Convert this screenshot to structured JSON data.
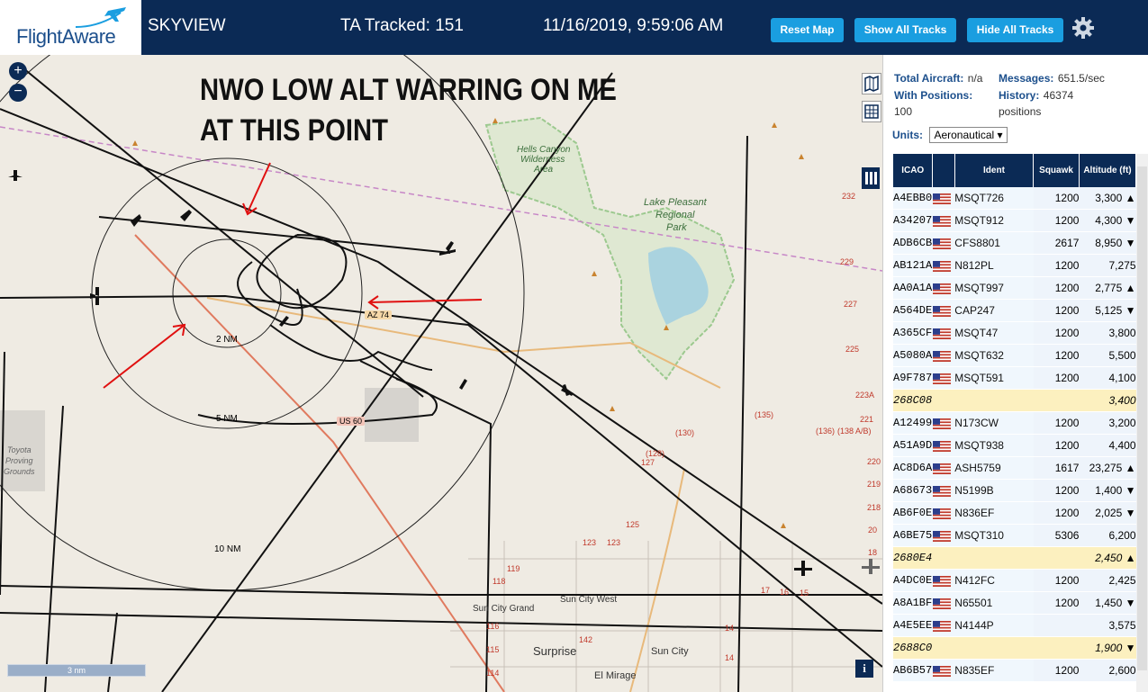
{
  "header": {
    "logo_text": "FlightAware",
    "app_title": "SKYVIEW",
    "tracked": "TA Tracked: 151",
    "datetime": "11/16/2019, 9:59:06 AM",
    "buttons": [
      "Reset Map",
      "Show All Tracks",
      "Hide All Tracks"
    ]
  },
  "annotation": {
    "line1": "NWO LOW ALT WARRING ON ME",
    "line2": "AT THIS POINT"
  },
  "map": {
    "ring_labels": [
      "2 NM",
      "5 NM",
      "10 NM"
    ],
    "places": [
      "Hells Canyon",
      "Wilderness",
      "Area",
      "Lake Pleasant",
      "Regional",
      "Park",
      "Toyota",
      "Proving",
      "Grounds",
      "Sun City West",
      "Sun City Grand",
      "Surprise",
      "Sun City",
      "El Mirage"
    ],
    "road_labels": [
      "AZ 74",
      "US 60"
    ],
    "route_numbers": [
      "(135)",
      "(130)",
      "(128)",
      "(136)",
      "(138 A/B)",
      "232",
      "229",
      "227",
      "225",
      "223A",
      "221",
      "220",
      "219",
      "218",
      "127",
      "125",
      "123",
      "123",
      "119",
      "118",
      "116",
      "115",
      "114",
      "142",
      "14",
      "14",
      "17",
      "16",
      "15",
      "20",
      "18"
    ],
    "scale_label": "3 nm"
  },
  "summary": {
    "total_label": "Total Aircraft:",
    "total_value": "n/a",
    "messages_label": "Messages:",
    "messages_value": "651.5/sec",
    "positions_label": "With Positions:",
    "positions_value": "100",
    "history_label": "History:",
    "history_value": "46374 positions",
    "units_label": "Units:",
    "units_value": "Aeronautical"
  },
  "table": {
    "headers": [
      "ICAO",
      "",
      "Ident",
      "Squawk",
      "Altitude (ft)"
    ],
    "rows": [
      {
        "icao": "A4EBB0",
        "flag": true,
        "ident": "MSQT726",
        "squawk": "1200",
        "alt": "3,300 ▲",
        "hl": false
      },
      {
        "icao": "A34207",
        "flag": true,
        "ident": "MSQT912",
        "squawk": "1200",
        "alt": "4,300 ▼",
        "hl": false
      },
      {
        "icao": "ADB6CB",
        "flag": true,
        "ident": "CFS8801",
        "squawk": "2617",
        "alt": "8,950 ▼",
        "hl": false
      },
      {
        "icao": "AB121A",
        "flag": true,
        "ident": "N812PL",
        "squawk": "1200",
        "alt": "7,275",
        "hl": false
      },
      {
        "icao": "AA0A1A",
        "flag": true,
        "ident": "MSQT997",
        "squawk": "1200",
        "alt": "2,775 ▲",
        "hl": false
      },
      {
        "icao": "A564DE",
        "flag": true,
        "ident": "CAP247",
        "squawk": "1200",
        "alt": "5,125 ▼",
        "hl": false
      },
      {
        "icao": "A365CF",
        "flag": true,
        "ident": "MSQT47",
        "squawk": "1200",
        "alt": "3,800",
        "hl": false
      },
      {
        "icao": "A5080A",
        "flag": true,
        "ident": "MSQT632",
        "squawk": "1200",
        "alt": "5,500",
        "hl": false
      },
      {
        "icao": "A9F787",
        "flag": true,
        "ident": "MSQT591",
        "squawk": "1200",
        "alt": "4,100",
        "hl": false
      },
      {
        "icao": "268C08",
        "flag": false,
        "ident": "",
        "squawk": "",
        "alt": "3,400",
        "hl": true
      },
      {
        "icao": "A12499",
        "flag": true,
        "ident": "N173CW",
        "squawk": "1200",
        "alt": "3,200",
        "hl": false
      },
      {
        "icao": "A51A9D",
        "flag": true,
        "ident": "MSQT938",
        "squawk": "1200",
        "alt": "4,400",
        "hl": false
      },
      {
        "icao": "AC8D6A",
        "flag": true,
        "ident": "ASH5759",
        "squawk": "1617",
        "alt": "23,275 ▲",
        "hl": false
      },
      {
        "icao": "A68673",
        "flag": true,
        "ident": "N5199B",
        "squawk": "1200",
        "alt": "1,400 ▼",
        "hl": false
      },
      {
        "icao": "AB6F0E",
        "flag": true,
        "ident": "N836EF",
        "squawk": "1200",
        "alt": "2,025 ▼",
        "hl": false
      },
      {
        "icao": "A6BE75",
        "flag": true,
        "ident": "MSQT310",
        "squawk": "5306",
        "alt": "6,200",
        "hl": false
      },
      {
        "icao": "2680E4",
        "flag": false,
        "ident": "",
        "squawk": "",
        "alt": "2,450 ▲",
        "hl": true
      },
      {
        "icao": "A4DC0E",
        "flag": true,
        "ident": "N412FC",
        "squawk": "1200",
        "alt": "2,425",
        "hl": false
      },
      {
        "icao": "A8A1BF",
        "flag": true,
        "ident": "N65501",
        "squawk": "1200",
        "alt": "1,450 ▼",
        "hl": false
      },
      {
        "icao": "A4E5EE",
        "flag": true,
        "ident": "N4144P",
        "squawk": "",
        "alt": "3,575",
        "hl": false
      },
      {
        "icao": "2688C0",
        "flag": false,
        "ident": "",
        "squawk": "",
        "alt": "1,900 ▼",
        "hl": true
      },
      {
        "icao": "AB6B57",
        "flag": true,
        "ident": "N835EF",
        "squawk": "1200",
        "alt": "2,600",
        "hl": false
      }
    ]
  },
  "colors": {
    "header_bg": "#0b2a55",
    "button_bg": "#1a9ee0",
    "map_bg": "#efebe3",
    "highlight_row": "#fcf0bf",
    "annotation_red": "#e01010"
  }
}
